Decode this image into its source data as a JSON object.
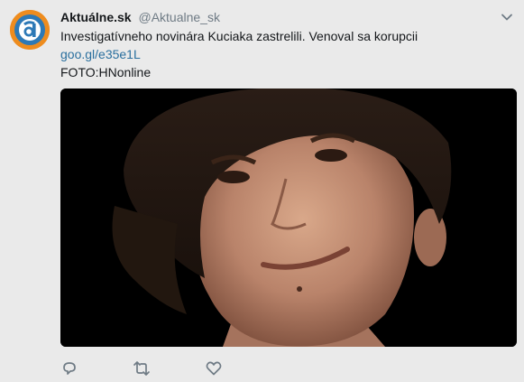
{
  "tweet": {
    "display_name": "Aktuálne.sk",
    "handle": "@Aktualne_sk",
    "text_line": "Investigatívneho novinára Kuciaka zastrelili. Venoval sa korupcii",
    "link": "goo.gl/e35e1L",
    "credit": "FOTO:HNonline"
  },
  "avatar": {
    "logo_letter": "a",
    "colors": {
      "orange": "#ee8c1e",
      "blue": "#2d79b6",
      "white": "#ffffff"
    }
  },
  "media": {
    "description_icon": "photo-portrait"
  },
  "icons": {
    "caret": "chevron-down-icon",
    "reply": "reply-icon",
    "retweet": "retweet-icon",
    "like": "heart-icon"
  },
  "colors": {
    "background": "#eaeaea",
    "text": "#14171a",
    "muted": "#6f7b85",
    "link": "#2a6f9e"
  }
}
